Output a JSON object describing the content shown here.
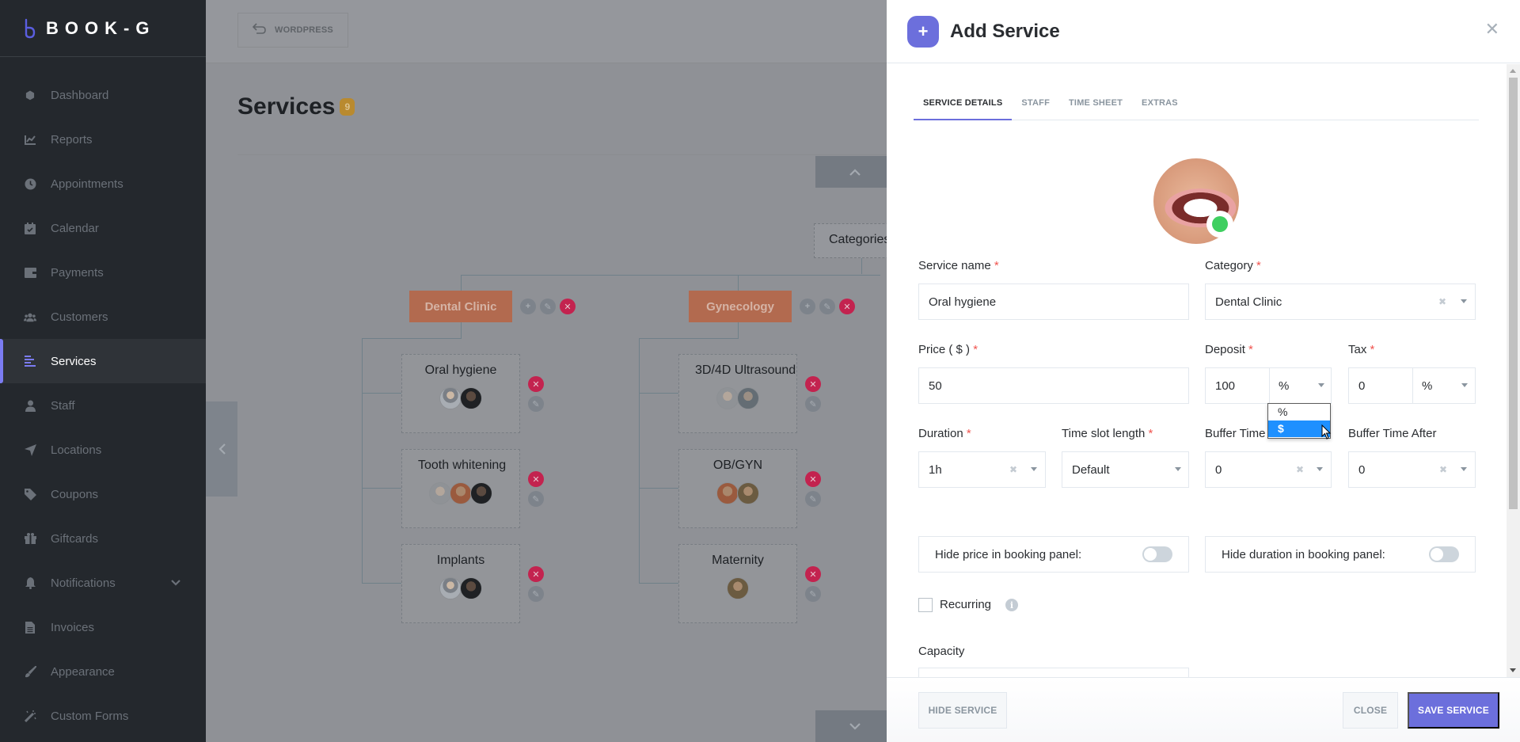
{
  "app": {
    "brand": "BOOK-G",
    "accent": "#6c6fdc"
  },
  "sidebar": {
    "items": [
      {
        "label": "Dashboard",
        "icon": "cube-icon",
        "glyph": "⬢"
      },
      {
        "label": "Reports",
        "icon": "chart-line-icon",
        "glyph": "📈"
      },
      {
        "label": "Appointments",
        "icon": "clock-icon",
        "glyph": "◷"
      },
      {
        "label": "Calendar",
        "icon": "calendar-check-icon",
        "glyph": "▦"
      },
      {
        "label": "Payments",
        "icon": "wallet-icon",
        "glyph": "▬"
      },
      {
        "label": "Customers",
        "icon": "users-icon",
        "glyph": "👥"
      },
      {
        "label": "Services",
        "icon": "list-icon",
        "glyph": "☰",
        "active": true
      },
      {
        "label": "Staff",
        "icon": "user-icon",
        "glyph": "👤"
      },
      {
        "label": "Locations",
        "icon": "location-arrow-icon",
        "glyph": "➤"
      },
      {
        "label": "Coupons",
        "icon": "tag-icon",
        "glyph": "🏷"
      },
      {
        "label": "Giftcards",
        "icon": "gift-icon",
        "glyph": "🎁"
      },
      {
        "label": "Notifications",
        "icon": "bell-icon",
        "glyph": "🔔",
        "expandable": true
      },
      {
        "label": "Invoices",
        "icon": "file-icon",
        "glyph": "▤"
      },
      {
        "label": "Appearance",
        "icon": "brush-icon",
        "glyph": "🖌"
      },
      {
        "label": "Custom Forms",
        "icon": "magic-wand-icon",
        "glyph": "✎"
      }
    ]
  },
  "main": {
    "back_button": "WORDPRESS",
    "page_title": "Services",
    "service_count": "9",
    "categories_root": "Categories",
    "categories": [
      {
        "name": "Dental Clinic",
        "services": [
          {
            "name": "Oral hygiene",
            "staff_count": 2
          },
          {
            "name": "Tooth whitening",
            "staff_count": 3
          },
          {
            "name": "Implants",
            "staff_count": 2
          }
        ]
      },
      {
        "name": "Gynecology",
        "services": [
          {
            "name": "3D/4D Ultrasound",
            "staff_count": 2
          },
          {
            "name": "OB/GYN",
            "staff_count": 2
          },
          {
            "name": "Maternity",
            "staff_count": 1
          }
        ]
      }
    ]
  },
  "drawer": {
    "title": "Add Service",
    "tabs": [
      {
        "label": "SERVICE DETAILS",
        "active": true
      },
      {
        "label": "STAFF"
      },
      {
        "label": "TIME SHEET"
      },
      {
        "label": "EXTRAS"
      }
    ],
    "form": {
      "service_name": {
        "label": "Service name",
        "value": "Oral hygiene"
      },
      "category": {
        "label": "Category",
        "value": "Dental Clinic"
      },
      "price": {
        "label": "Price ( $ )",
        "value": "50"
      },
      "deposit": {
        "label": "Deposit",
        "value": "100",
        "unit": "%",
        "unit_options": [
          "%",
          "$"
        ],
        "highlighted_option": "$"
      },
      "tax": {
        "label": "Tax",
        "value": "0",
        "unit": "%"
      },
      "duration": {
        "label": "Duration",
        "value": "1h"
      },
      "time_slot_length": {
        "label": "Time slot length",
        "value": "Default"
      },
      "buffer_before": {
        "label": "Buffer Time Before",
        "value": "0"
      },
      "buffer_after": {
        "label": "Buffer Time After",
        "value": "0"
      },
      "hide_price": {
        "label": "Hide price in booking panel:",
        "on": false
      },
      "hide_duration": {
        "label": "Hide duration in booking panel:",
        "on": false
      },
      "recurring": {
        "label": "Recurring",
        "checked": false
      },
      "capacity": {
        "label": "Capacity",
        "value": ""
      }
    },
    "footer": {
      "hide_service": "HIDE SERVICE",
      "close": "CLOSE",
      "save": "SAVE SERVICE"
    }
  }
}
